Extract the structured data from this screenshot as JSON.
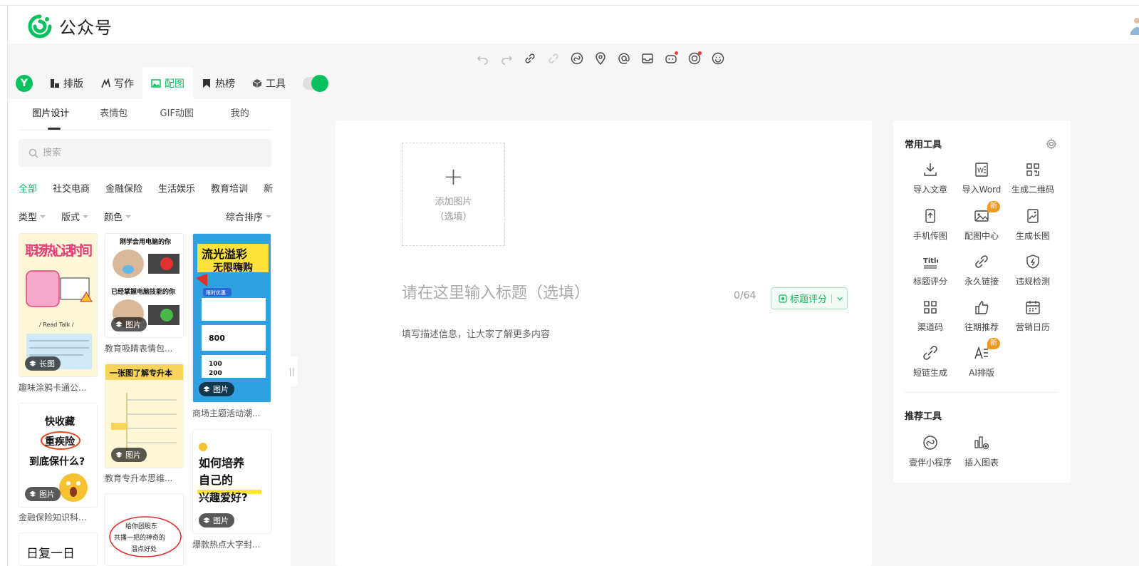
{
  "app": {
    "name": "公众号"
  },
  "nav": {
    "tabs": [
      {
        "label": "排版"
      },
      {
        "label": "写作"
      },
      {
        "label": "配图"
      },
      {
        "label": "热榜"
      },
      {
        "label": "工具"
      }
    ],
    "active_tab": 2
  },
  "left_panel": {
    "sub_tabs": [
      {
        "label": "图片设计"
      },
      {
        "label": "表情包"
      },
      {
        "label": "GIF动图"
      },
      {
        "label": "我的"
      }
    ],
    "search": {
      "placeholder": "搜索",
      "value": ""
    },
    "categories": [
      {
        "label": "全部"
      },
      {
        "label": "社交电商"
      },
      {
        "label": "金融保险"
      },
      {
        "label": "生活娱乐"
      },
      {
        "label": "教育培训"
      },
      {
        "label": "新"
      }
    ],
    "filters": {
      "type": "类型",
      "layout": "版式",
      "color": "颜色",
      "sort": "综合排序"
    },
    "templates": [
      {
        "caption": "趣味涂鸦卡通公...",
        "tag": "长图"
      },
      {
        "caption": "金融保险知识科...",
        "tag": "图片"
      },
      {
        "caption": "教育吸睛表情包...",
        "tag": "图片"
      },
      {
        "caption": "教育专升本思维...",
        "tag": "图片"
      },
      {
        "caption": "商场主题活动潮...",
        "tag": "图片"
      },
      {
        "caption": "爆款热点大字封...",
        "tag": "图片"
      }
    ],
    "thumb_text": {
      "t1": "职场热心话时间",
      "t1b": "/ Read Talk /",
      "t2a": "快收藏",
      "t2b": "重疾险",
      "t2c": "到底保什么?",
      "t3a": "刚学会用电脑的你",
      "t3b": "已经掌握电脑技能的你",
      "t4": "一张图了解专升本",
      "t5a": "流光溢彩",
      "t5b": "无限嗨购",
      "t5c": "限时优惠",
      "t5d": "800",
      "t5e": "100",
      "t5f": "200",
      "t6a": "如何培养",
      "t6b": "自己的",
      "t6c": "兴趣爱好?",
      "t7": "日复一日",
      "t8a": "给你团股东",
      "t8b": "共播一把的神奇的",
      "t8c": "溜点好处"
    }
  },
  "editor": {
    "add_image": {
      "label": "添加图片",
      "hint": "（选填）"
    },
    "title": {
      "placeholder": "请在这里输入标题（选填）",
      "value": ""
    },
    "counter": "0/64",
    "score_button": "标题评分",
    "description_placeholder": "填写描述信息，让大家了解更多内容"
  },
  "right_panel": {
    "common_title": "常用工具",
    "common_tools": [
      {
        "label": "导入文章",
        "icon": "import-icon"
      },
      {
        "label": "导入Word",
        "icon": "word-icon"
      },
      {
        "label": "生成二维码",
        "icon": "qrcode-icon"
      },
      {
        "label": "手机传图",
        "icon": "phone-upload-icon"
      },
      {
        "label": "配图中心",
        "icon": "image-center-icon",
        "badge": "新"
      },
      {
        "label": "生成长图",
        "icon": "long-image-icon"
      },
      {
        "label": "标题评分",
        "icon": "title-score-icon"
      },
      {
        "label": "永久链接",
        "icon": "link-icon"
      },
      {
        "label": "违规检测",
        "icon": "shield-check-icon"
      },
      {
        "label": "渠道码",
        "icon": "channel-code-icon"
      },
      {
        "label": "往期推荐",
        "icon": "thumbs-up-icon"
      },
      {
        "label": "营销日历",
        "icon": "calendar-icon"
      },
      {
        "label": "短链生成",
        "icon": "short-link-icon"
      },
      {
        "label": "AI排版",
        "icon": "ai-layout-icon",
        "badge": "新"
      }
    ],
    "recommend_title": "推荐工具",
    "recommend_tools": [
      {
        "label": "壹伴小程序",
        "icon": "mini-program-icon"
      },
      {
        "label": "插入图表",
        "icon": "chart-insert-icon"
      }
    ],
    "title_icon_text": "Title"
  },
  "colors": {
    "brand": "#07c160",
    "badge": "#f29a1f",
    "alert_dot": "#f23c3c"
  }
}
